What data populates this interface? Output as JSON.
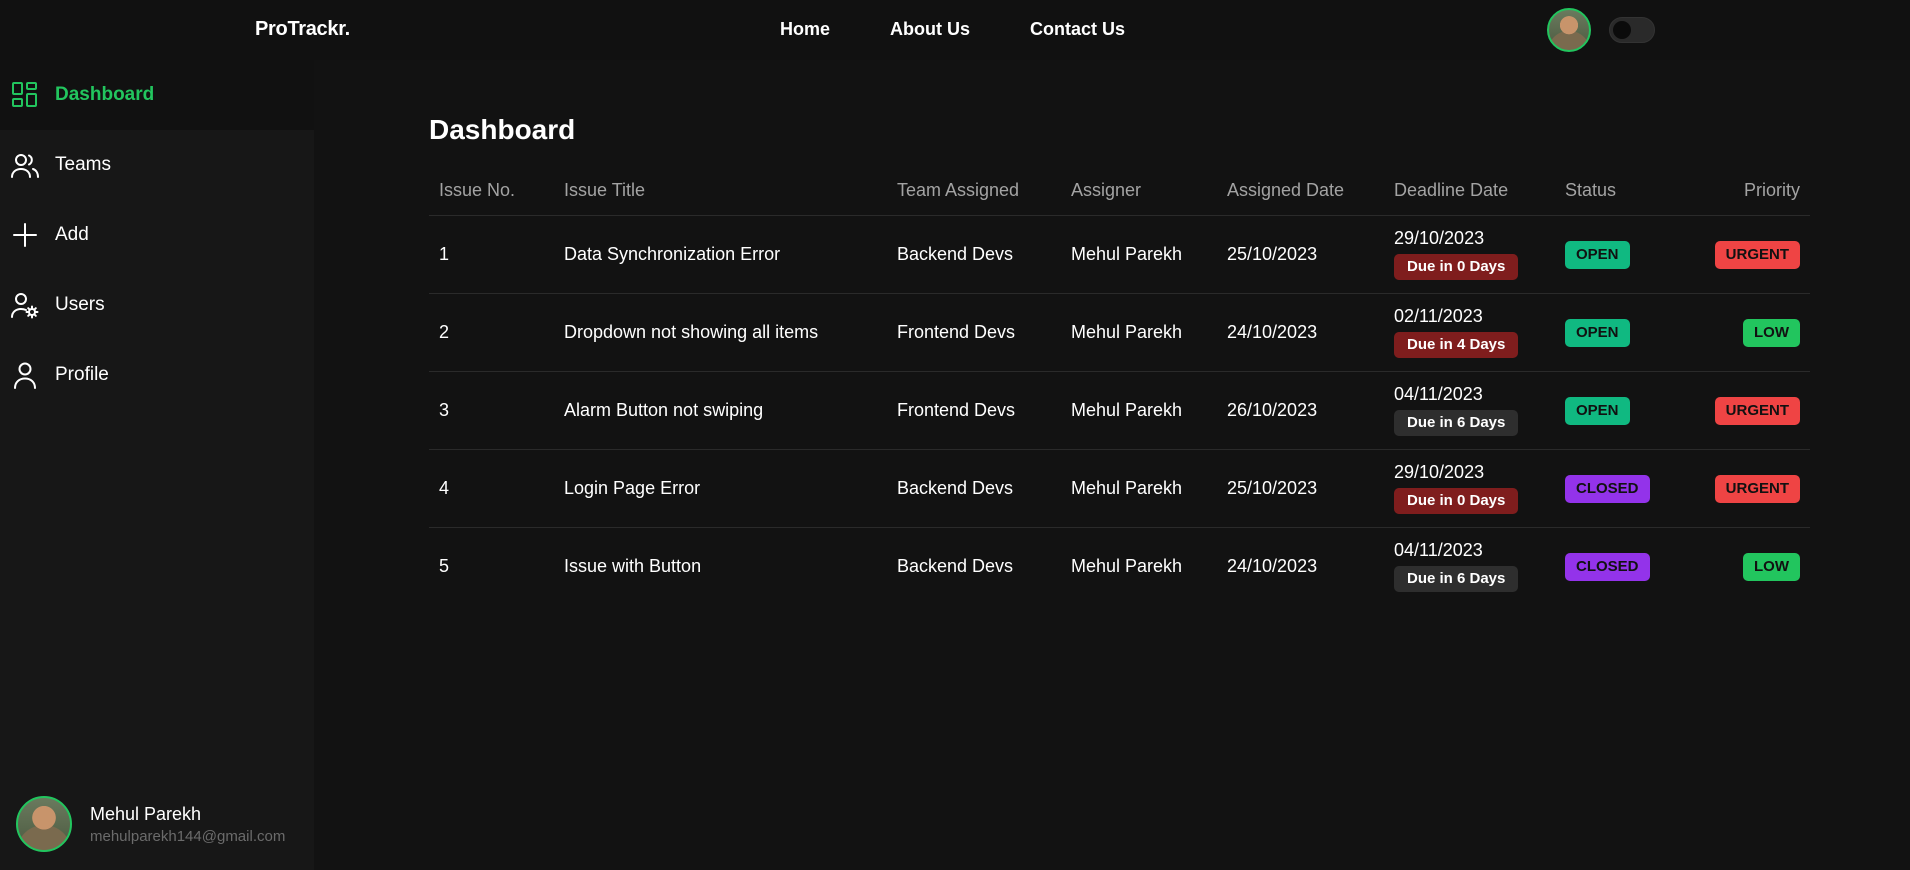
{
  "header": {
    "brand": "ProTrackr.",
    "nav": [
      "Home",
      "About Us",
      "Contact Us"
    ]
  },
  "sidebar": {
    "items": [
      {
        "label": "Dashboard",
        "icon": "dashboard-grid-icon",
        "active": true
      },
      {
        "label": "Teams",
        "icon": "users-group-icon",
        "active": false
      },
      {
        "label": "Add",
        "icon": "plus-icon",
        "active": false
      },
      {
        "label": "Users",
        "icon": "user-settings-icon",
        "active": false
      },
      {
        "label": "Profile",
        "icon": "user-icon",
        "active": false
      }
    ],
    "user": {
      "name": "Mehul Parekh",
      "email": "mehulparekh144@gmail.com"
    }
  },
  "main": {
    "title": "Dashboard",
    "columns": [
      "Issue No.",
      "Issue Title",
      "Team Assigned",
      "Assigner",
      "Assigned Date",
      "Deadline Date",
      "Status",
      "Priority"
    ],
    "rows": [
      {
        "no": "1",
        "title": "Data Synchronization Error",
        "team": "Backend Devs",
        "assigner": "Mehul Parekh",
        "assigned": "25/10/2023",
        "deadline": "29/10/2023",
        "due": "Due in 0 Days",
        "due_color": "red",
        "status": "OPEN",
        "priority": "URGENT"
      },
      {
        "no": "2",
        "title": "Dropdown not showing all items",
        "team": "Frontend Devs",
        "assigner": "Mehul Parekh",
        "assigned": "24/10/2023",
        "deadline": "02/11/2023",
        "due": "Due in 4 Days",
        "due_color": "red",
        "status": "OPEN",
        "priority": "LOW"
      },
      {
        "no": "3",
        "title": "Alarm Button not swiping",
        "team": "Frontend Devs",
        "assigner": "Mehul Parekh",
        "assigned": "26/10/2023",
        "deadline": "04/11/2023",
        "due": "Due in 6 Days",
        "due_color": "gray",
        "status": "OPEN",
        "priority": "URGENT"
      },
      {
        "no": "4",
        "title": "Login Page Error",
        "team": "Backend Devs",
        "assigner": "Mehul Parekh",
        "assigned": "25/10/2023",
        "deadline": "29/10/2023",
        "due": "Due in 0 Days",
        "due_color": "red",
        "status": "CLOSED",
        "priority": "URGENT"
      },
      {
        "no": "5",
        "title": "Issue with Button",
        "team": "Backend Devs",
        "assigner": "Mehul Parekh",
        "assigned": "24/10/2023",
        "deadline": "04/11/2023",
        "due": "Due in 6 Days",
        "due_color": "gray",
        "status": "CLOSED",
        "priority": "LOW"
      }
    ]
  },
  "colors": {
    "accent": "#22c55e",
    "open": "#10b981",
    "closed": "#9333ea",
    "urgent": "#ef4444",
    "low": "#22c55e",
    "due_red": "#7f1d1d"
  }
}
